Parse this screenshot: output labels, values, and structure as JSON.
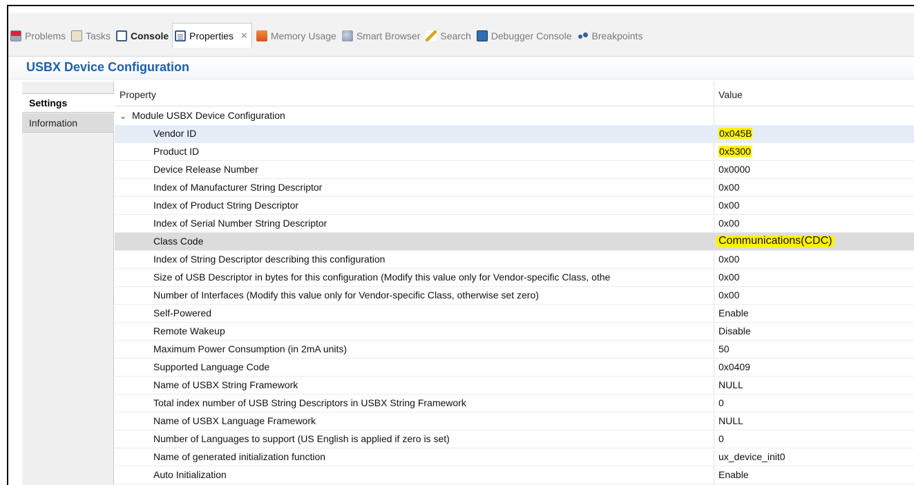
{
  "tabs": [
    {
      "label": "Problems",
      "icon": "problems-icon"
    },
    {
      "label": "Tasks",
      "icon": "tasks-icon"
    },
    {
      "label": "Console",
      "icon": "console-icon"
    },
    {
      "label": "Properties",
      "icon": "properties-icon",
      "close": "✕"
    },
    {
      "label": "Memory Usage",
      "icon": "memory-usage-icon"
    },
    {
      "label": "Smart Browser",
      "icon": "smart-browser-icon"
    },
    {
      "label": "Search",
      "icon": "search-icon"
    },
    {
      "label": "Debugger Console",
      "icon": "debugger-console-icon"
    },
    {
      "label": "Breakpoints",
      "icon": "breakpoints-icon"
    }
  ],
  "panel_title": "USBX Device Configuration",
  "side_tabs": {
    "settings": "Settings",
    "information": "Information"
  },
  "table": {
    "header_property": "Property",
    "header_value": "Value",
    "group_label": "Module USBX Device Configuration",
    "group_chevron": "⌄",
    "rows": [
      {
        "property": "Vendor ID",
        "value": "0x045B"
      },
      {
        "property": "Product ID",
        "value": "0x5300"
      },
      {
        "property": "Device Release Number",
        "value": "0x0000"
      },
      {
        "property": "Index of Manufacturer String Descriptor",
        "value": "0x00"
      },
      {
        "property": "Index of Product String Descriptor",
        "value": "0x00"
      },
      {
        "property": "Index of Serial Number String Descriptor",
        "value": "0x00"
      },
      {
        "property": "Class Code",
        "value": "Communications(CDC)"
      },
      {
        "property": "Index of String Descriptor describing this configuration",
        "value": "0x00"
      },
      {
        "property": "Size of USB Descriptor in bytes for this configuration (Modify this value only for Vendor-specific Class, othe",
        "value": "0x00"
      },
      {
        "property": "Number of Interfaces (Modify this value only for Vendor-specific Class, otherwise set zero)",
        "value": "0x00"
      },
      {
        "property": "Self-Powered",
        "value": "Enable"
      },
      {
        "property": "Remote Wakeup",
        "value": "Disable"
      },
      {
        "property": "Maximum Power Consumption (in 2mA units)",
        "value": "50"
      },
      {
        "property": "Supported Language Code",
        "value": "0x0409"
      },
      {
        "property": "Name of USBX String Framework",
        "value": "NULL"
      },
      {
        "property": "Total index number of USB String Descriptors in USBX String Framework",
        "value": "0"
      },
      {
        "property": "Name of USBX Language Framework",
        "value": "NULL"
      },
      {
        "property": "Number of Languages to support (US English is applied if zero is set)",
        "value": "0"
      },
      {
        "property": "Name of generated initialization function",
        "value": "ux_device_init0"
      },
      {
        "property": "Auto Initialization",
        "value": "Enable"
      }
    ]
  },
  "colors": {
    "highlight": "#fff200",
    "title": "#1e5fa8"
  }
}
